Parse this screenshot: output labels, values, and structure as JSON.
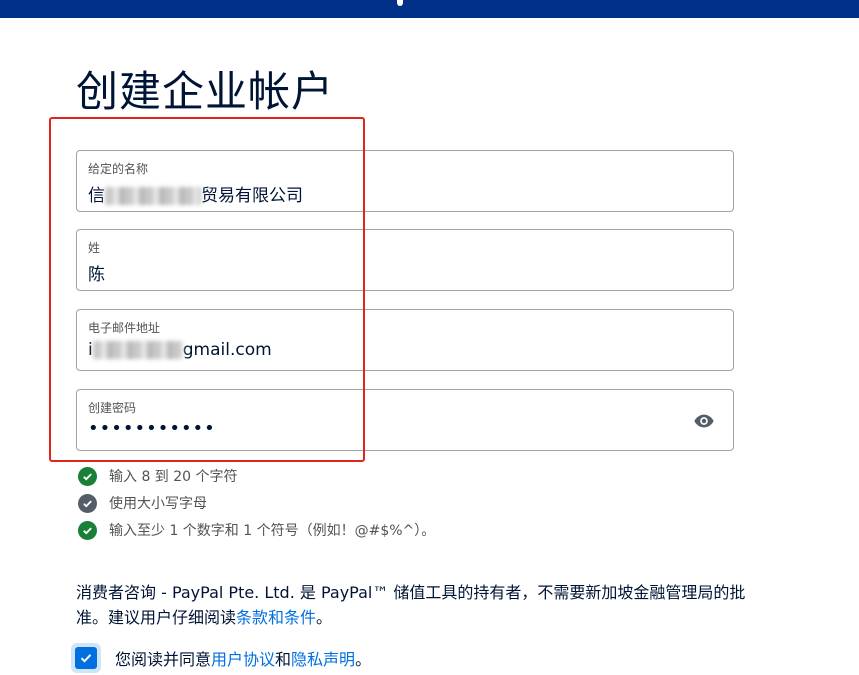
{
  "page_title": "创建企业帐户",
  "fields": [
    {
      "label": "给定的名称",
      "value_visible": "贸易有限公司",
      "value_prefix_visible": "信"
    },
    {
      "label": "姓",
      "value": "陈"
    },
    {
      "label": "电子邮件地址",
      "value_visible": "gmail.com",
      "value_prefix_visible": "i"
    },
    {
      "label": "创建密码",
      "value": "•••••••••••",
      "toggle_icon": "eye-icon"
    }
  ],
  "password_rules": [
    {
      "text": "输入 8 到 20 个字符",
      "status": "met",
      "color": "#1a7f37"
    },
    {
      "text": "使用大小写字母",
      "status": "neutral",
      "color": "#545d68"
    },
    {
      "text": "输入至少 1 个数字和 1 个符号（例如！@#$%^）。",
      "status": "met",
      "color": "#1a7f37"
    }
  ],
  "consumer_notice": {
    "text": "消费者咨询 - PayPal Pte. Ltd. 是 PayPal™ 储值工具的持有者，不需要新加坡金融管理局的批准。建议用户仔细阅读",
    "link": "条款和条件",
    "suffix": "。"
  },
  "agreement": {
    "checked": true,
    "prefix": "您阅读并同意",
    "link1": "用户协议",
    "middle": "和",
    "link2": "隐私声明",
    "suffix": "。"
  },
  "colors": {
    "brand_bar": "#003087",
    "link": "#0070e0",
    "annotation_box": "#e0251b",
    "check_ok": "#1a7f37",
    "check_neutral": "#545d68"
  }
}
